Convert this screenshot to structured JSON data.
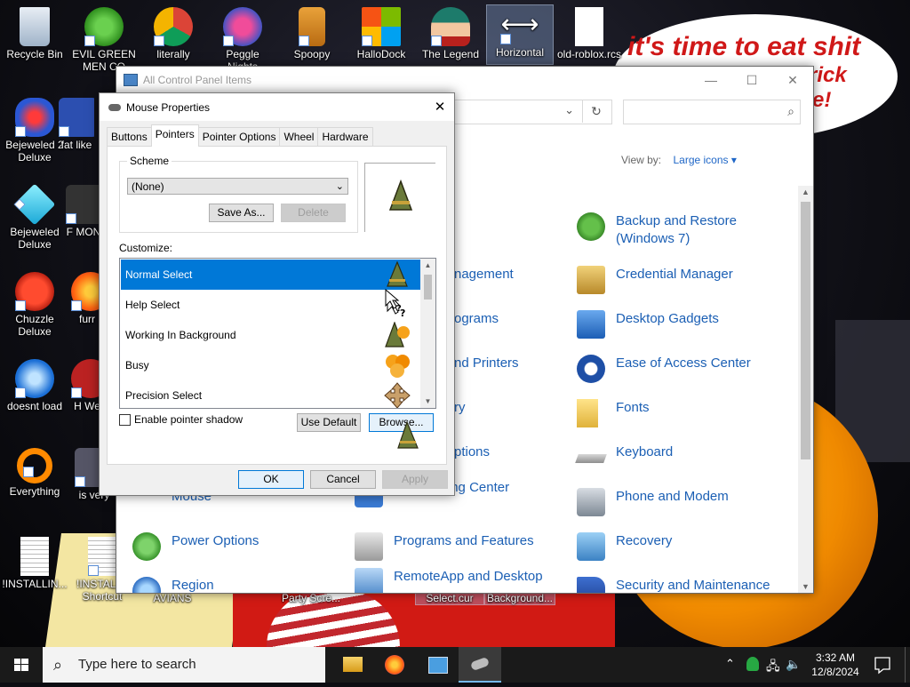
{
  "wallpaper": {
    "bubble_text": "it's time to eat shit",
    "bubble_text_2": "trick",
    "bubble_text_3": "te!"
  },
  "desktop_icons": [
    {
      "label": "Recycle Bin",
      "icon": "recycle-bin-icon"
    },
    {
      "label": "EVIL GREEN MEN CO",
      "icon": "messenger-icon"
    },
    {
      "label": "literally",
      "icon": "chrome-icon"
    },
    {
      "label": "Peggle Nights",
      "icon": "peggle-icon"
    },
    {
      "label": "Spoopy",
      "icon": "folder-icon"
    },
    {
      "label": "HalloDock",
      "icon": "windows-logo-icon"
    },
    {
      "label": "The Legend",
      "icon": "character-icon"
    },
    {
      "label": "Horizontal",
      "icon": "horizontal-resize-icon"
    },
    {
      "label": "old-roblox.rcs",
      "icon": "file-icon"
    },
    {
      "label": "Bejeweled 2 Deluxe",
      "icon": "bejeweled2-icon"
    },
    {
      "label": "fat like",
      "icon": "app-icon"
    },
    {
      "label": "Bejeweled Deluxe",
      "icon": "gem-icon"
    },
    {
      "label": "F MON",
      "icon": "app-icon"
    },
    {
      "label": "Chuzzle Deluxe",
      "icon": "chuzzle-icon"
    },
    {
      "label": "furr",
      "icon": "firefox-icon"
    },
    {
      "label": "doesnt load",
      "icon": "thunderbird-icon"
    },
    {
      "label": "H We",
      "icon": "app-icon"
    },
    {
      "label": "Everything",
      "icon": "search-app-icon"
    },
    {
      "label": "is very",
      "icon": "app-icon"
    },
    {
      "label": "!INSTALLIN...",
      "icon": "document-icon"
    },
    {
      "label": "!INSTALL - Shortcut",
      "icon": "document-icon"
    },
    {
      "label": "AVIANS",
      "icon": "app-icon"
    },
    {
      "label": "Party Scre...",
      "icon": "app-icon"
    },
    {
      "label": "Select.cur",
      "icon": "cursor-file-icon"
    },
    {
      "label": "Background...",
      "icon": "image-file-icon"
    }
  ],
  "control_panel": {
    "title": "All Control Panel Items",
    "view_by_label": "View by:",
    "view_by_value": "Large icons",
    "items_left_partial": [
      "nagement",
      "ograms",
      "nd Printers",
      "ry",
      "ptions",
      "and Sharing Center",
      "Mouse"
    ],
    "items": [
      {
        "label": "Backup and Restore (Windows 7)",
        "icon": "backup-icon"
      },
      {
        "label": "Credential Manager",
        "icon": "credential-icon"
      },
      {
        "label": "Desktop Gadgets",
        "icon": "gadgets-icon"
      },
      {
        "label": "Ease of Access Center",
        "icon": "ease-of-access-icon"
      },
      {
        "label": "Fonts",
        "icon": "fonts-icon"
      },
      {
        "label": "Keyboard",
        "icon": "keyboard-icon"
      },
      {
        "label": "Phone and Modem",
        "icon": "phone-icon"
      },
      {
        "label": "Recovery",
        "icon": "recovery-icon"
      },
      {
        "label": "Security and Maintenance",
        "icon": "flag-icon"
      }
    ],
    "bottom_row": [
      {
        "label": "Power Options",
        "icon": "power-icon"
      },
      {
        "label": "Programs and Features",
        "icon": "programs-icon"
      },
      {
        "label": "Region",
        "icon": "region-icon"
      },
      {
        "label": "RemoteApp and Desktop",
        "icon": "remote-icon"
      }
    ]
  },
  "mouse_properties": {
    "title": "Mouse Properties",
    "tabs": [
      "Buttons",
      "Pointers",
      "Pointer Options",
      "Wheel",
      "Hardware"
    ],
    "active_tab": "Pointers",
    "scheme_label": "Scheme",
    "scheme_value": "(None)",
    "save_as": "Save As...",
    "delete": "Delete",
    "customize_label": "Customize:",
    "cursors": [
      {
        "label": "Normal Select",
        "icon": "witch-hat-cursor-icon",
        "selected": true
      },
      {
        "label": "Help Select",
        "icon": "help-cursor-icon",
        "selected": false
      },
      {
        "label": "Working In Background",
        "icon": "working-cursor-icon",
        "selected": false
      },
      {
        "label": "Busy",
        "icon": "busy-cursor-icon",
        "selected": false
      },
      {
        "label": "Precision Select",
        "icon": "move-cursor-icon",
        "selected": false
      }
    ],
    "enable_shadow": "Enable pointer shadow",
    "use_default": "Use Default",
    "browse": "Browse...",
    "ok": "OK",
    "cancel": "Cancel",
    "apply": "Apply"
  },
  "taskbar": {
    "search_placeholder": "Type here to search",
    "time": "3:32 AM",
    "date": "12/8/2024"
  },
  "colors": {
    "accent": "#0078d7",
    "link": "#1b5fb4"
  }
}
